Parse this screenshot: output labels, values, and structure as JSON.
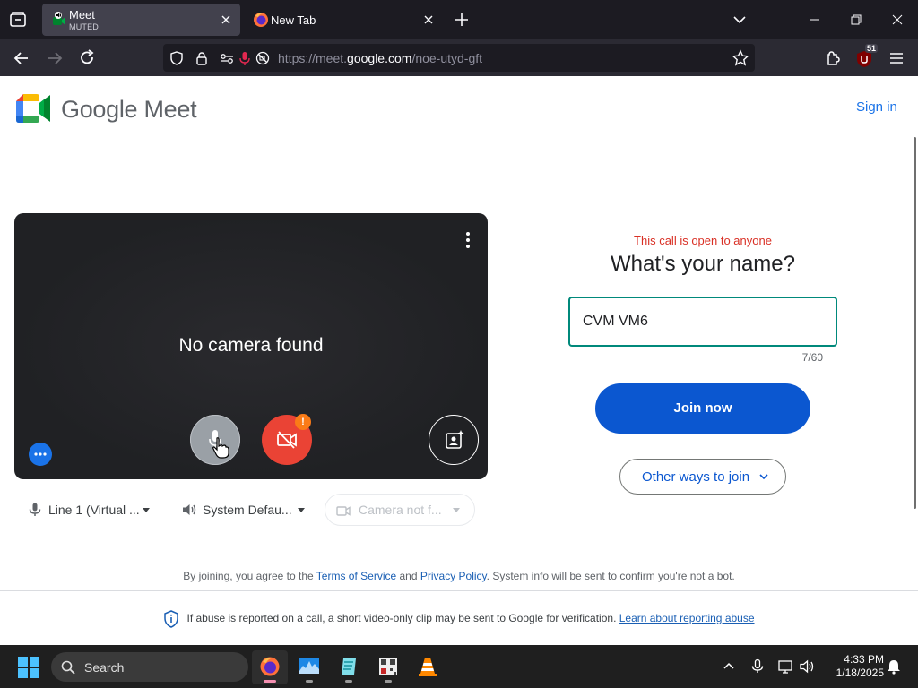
{
  "browser": {
    "tabs": [
      {
        "title": "Meet",
        "subtitle": "MUTED",
        "active": true
      },
      {
        "title": "New Tab",
        "active": false
      }
    ],
    "url": {
      "prefix": "https://meet.",
      "host": "google.com",
      "path": "/noe-utyd-gft"
    },
    "extension_badge": "51"
  },
  "header": {
    "brand": "Google Meet",
    "signin": "Sign in"
  },
  "preview": {
    "message": "No camera found",
    "mic": {
      "label": "Line 1 (Virtual ..."
    },
    "speaker": {
      "label": "System Defau..."
    },
    "camera": {
      "label": "Camera not f..."
    },
    "camera_warning": "!"
  },
  "join": {
    "open_note": "This call is open to anyone",
    "prompt": "What's your name?",
    "name_value": "CVM VM6",
    "char_count": "7/60",
    "join_button": "Join now",
    "other_ways": "Other ways to join"
  },
  "footer": {
    "terms_prefix": "By joining, you agree to the ",
    "terms_link": "Terms of Service",
    "terms_and": " and ",
    "privacy_link": "Privacy Policy",
    "terms_suffix": ". System info will be sent to confirm you're not a bot.",
    "abuse_text": "If abuse is reported on a call, a short video-only clip may be sent to Google for verification. ",
    "abuse_link": "Learn about reporting abuse"
  },
  "taskbar": {
    "search_label": "Search",
    "time": "4:33 PM",
    "date": "1/18/2025"
  },
  "colors": {
    "accent_blue": "#0b57d0",
    "link_blue": "#1a73e8",
    "alert_red": "#d93025",
    "input_border": "#00897b",
    "cam_off_red": "#ea4335"
  }
}
